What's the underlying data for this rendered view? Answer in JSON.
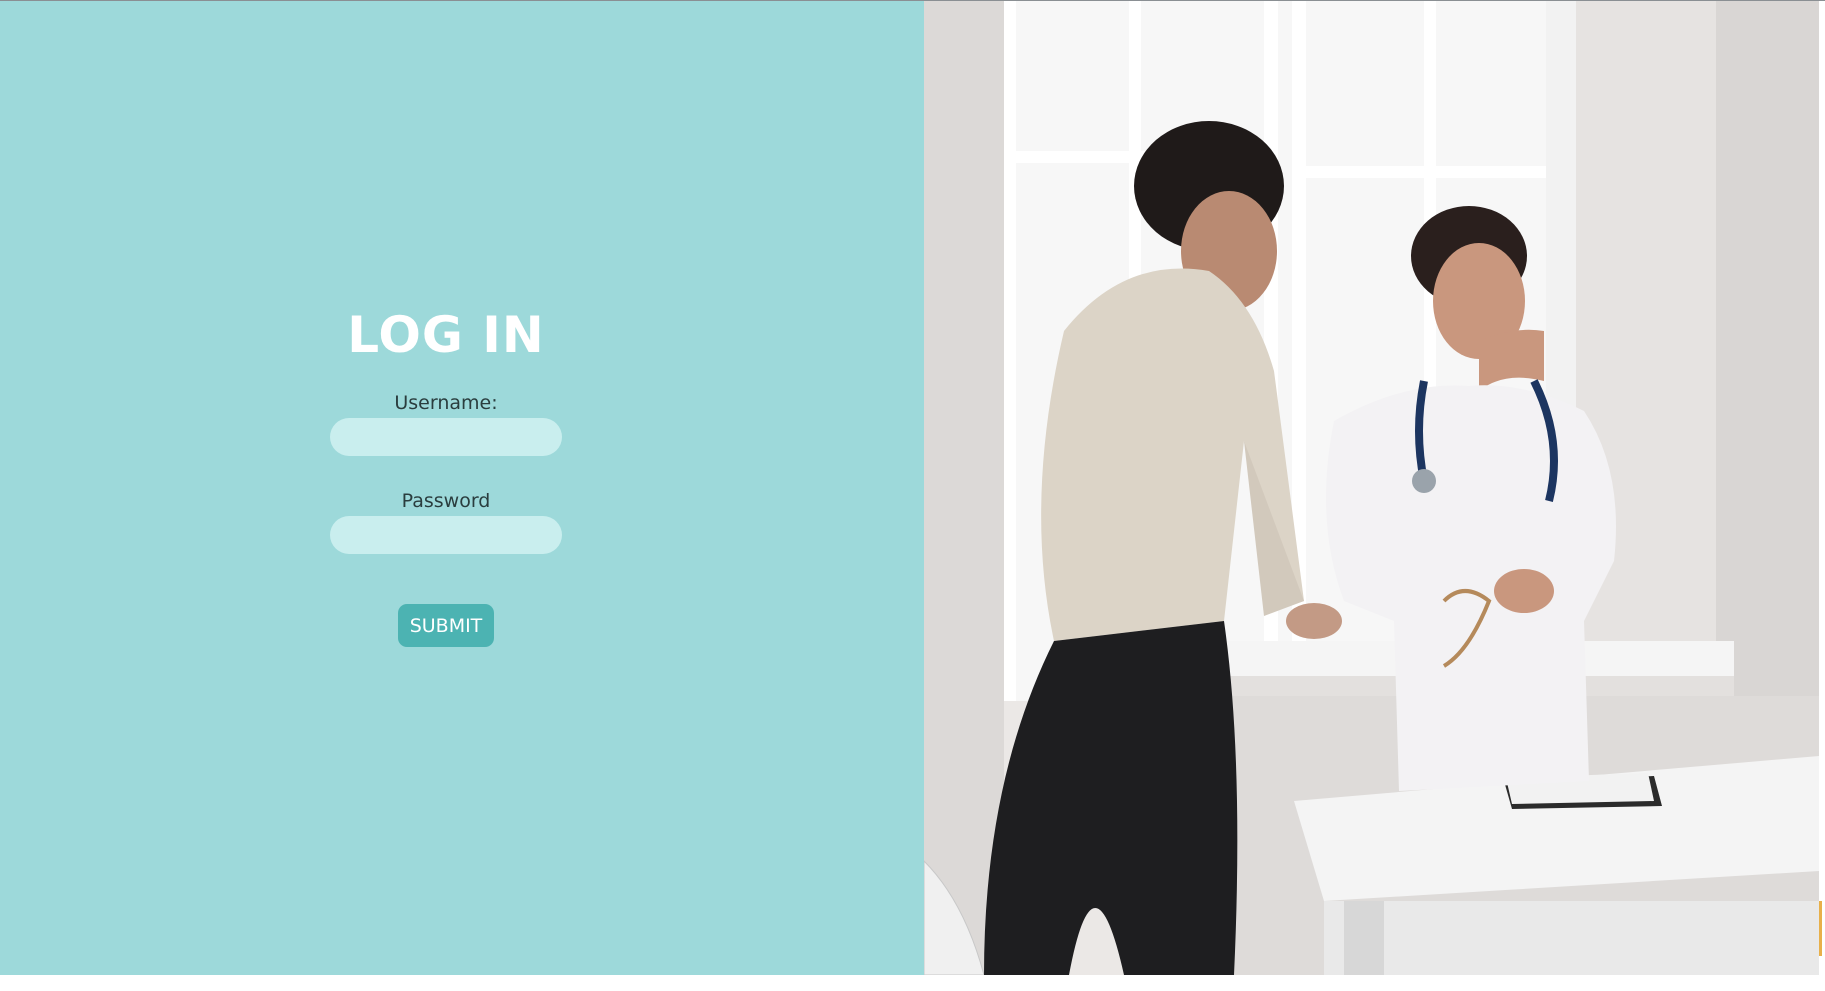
{
  "login": {
    "title": "LOG IN",
    "username_label": "Username:",
    "username_value": "",
    "password_label": "Password",
    "password_value": "",
    "submit_label": "SUBMIT"
  },
  "colors": {
    "panel": "#9dd9da",
    "field": "#c9eeee",
    "button": "#4cb3b2",
    "title": "#ffffff"
  },
  "photo": {
    "icon": "doctor-patient-handshake-image"
  }
}
